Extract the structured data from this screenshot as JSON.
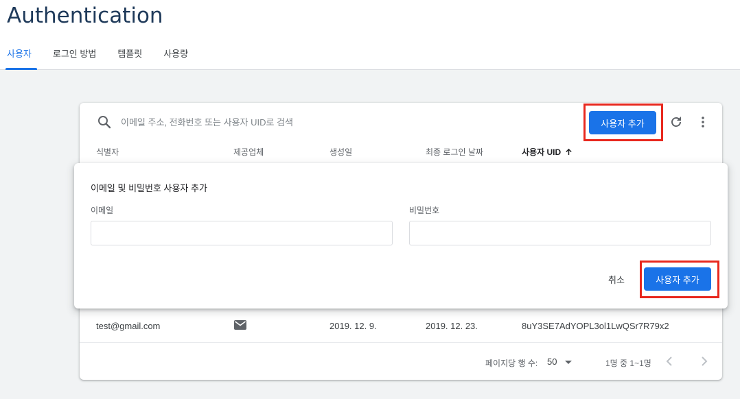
{
  "page": {
    "title": "Authentication"
  },
  "tabs": [
    {
      "label": "사용자",
      "active": true
    },
    {
      "label": "로그인 방법",
      "active": false
    },
    {
      "label": "템플릿",
      "active": false
    },
    {
      "label": "사용량",
      "active": false
    }
  ],
  "toolbar": {
    "search_placeholder": "이메일 주소, 전화번호 또는 사용자 UID로 검색",
    "add_user_label": "사용자 추가"
  },
  "table": {
    "columns": [
      "식별자",
      "제공업체",
      "생성일",
      "최종 로그인 날짜",
      "사용자 UID"
    ],
    "sorted_column": "사용자 UID",
    "sort_direction": "ascending",
    "rows": [
      {
        "identifier": "test@gmail.com",
        "provider_icon": "mail-icon",
        "created": "2019. 12. 9.",
        "last_login": "2019. 12. 23.",
        "uid": "8uY3SE7AdYOPL3ol1LwQSr7R79x2"
      }
    ]
  },
  "pagination": {
    "rows_per_page_label": "페이지당 행 수:",
    "rows_per_page": "50",
    "range_text": "1명 중 1~1명"
  },
  "dialog": {
    "title": "이메일 및 비밀번호 사용자 추가",
    "email_label": "이메일",
    "password_label": "비밀번호",
    "email_value": "",
    "password_value": "",
    "cancel_label": "취소",
    "add_label": "사용자 추가"
  },
  "colors": {
    "primary": "#1a73e8",
    "highlight": "#e8281e",
    "title": "#1f3a5a"
  }
}
